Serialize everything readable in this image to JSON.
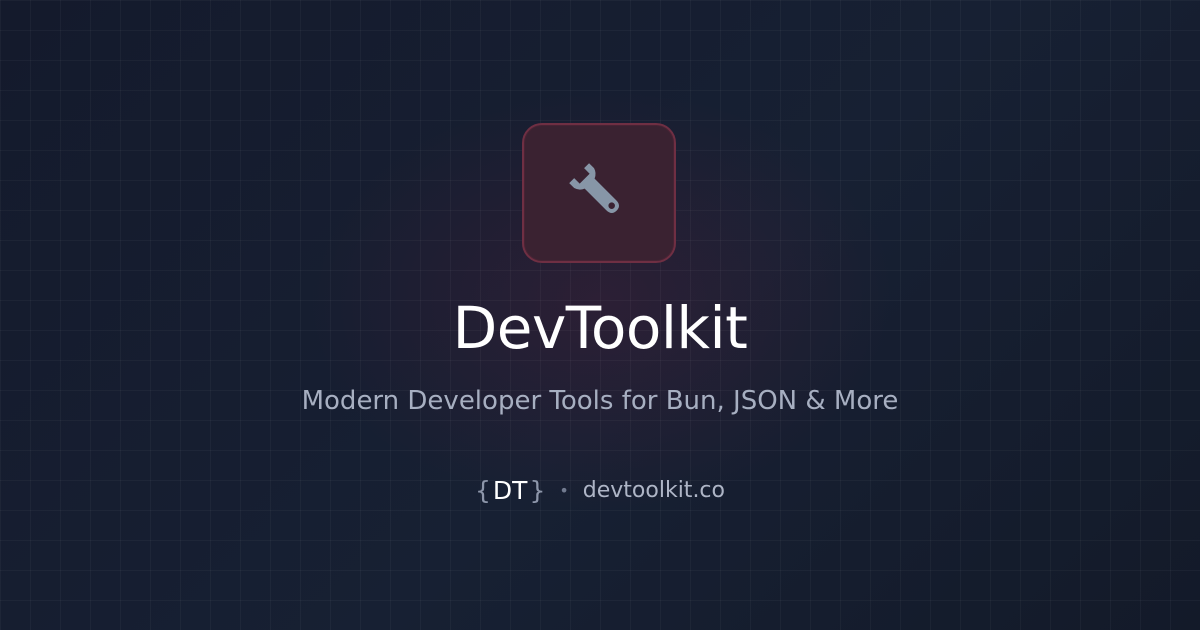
{
  "hero": {
    "icon_name": "wrench-icon",
    "title": "DevToolkit",
    "subtitle": "Modern Developer Tools for Bun, JSON & More"
  },
  "footer": {
    "brand_open": "{",
    "brand_text": "DT",
    "brand_close": "}",
    "separator": "•",
    "url": "devtoolkit.co"
  },
  "colors": {
    "background": "#121a2b",
    "tile_background": "#3a2231",
    "tile_border": "#6f2f43",
    "icon": "#8796a7",
    "title": "#ffffff",
    "subtitle": "#a7afc1"
  }
}
